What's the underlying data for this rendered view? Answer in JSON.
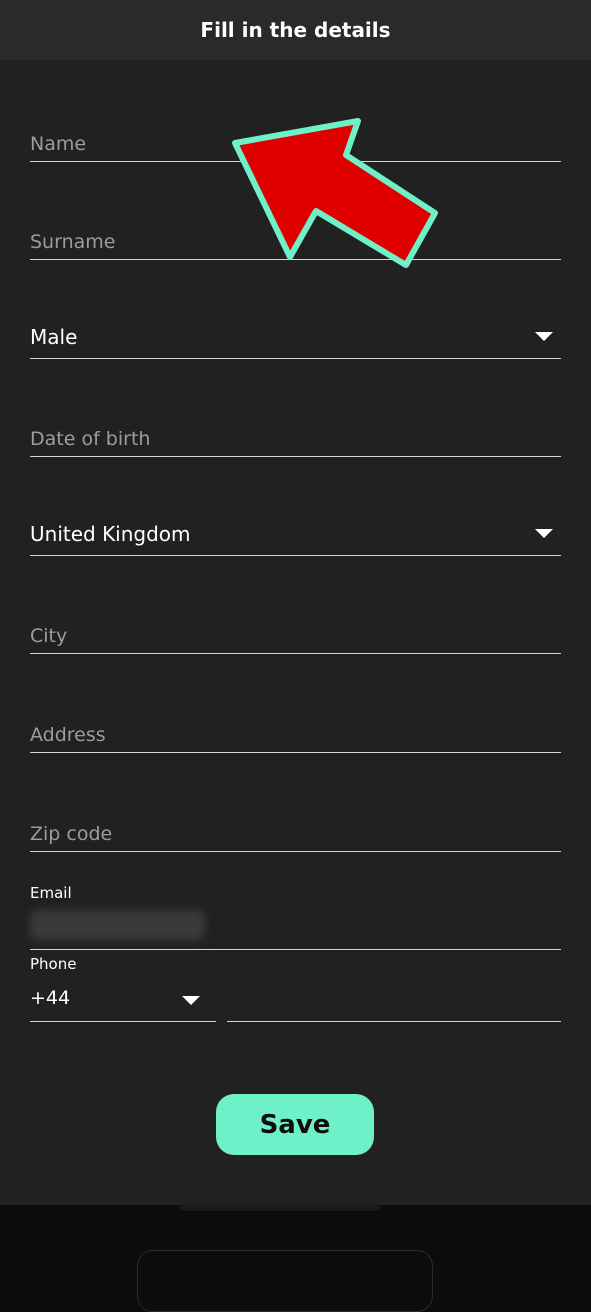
{
  "header": {
    "title": "Fill in the details"
  },
  "form": {
    "name": {
      "placeholder": "Name",
      "value": ""
    },
    "surname": {
      "placeholder": "Surname",
      "value": ""
    },
    "gender": {
      "selected": "Male"
    },
    "dob": {
      "placeholder": "Date of birth",
      "value": ""
    },
    "country": {
      "selected": "United Kingdom"
    },
    "city": {
      "placeholder": "City",
      "value": ""
    },
    "address": {
      "placeholder": "Address",
      "value": ""
    },
    "zip": {
      "placeholder": "Zip code",
      "value": ""
    },
    "email": {
      "label": "Email"
    },
    "phone": {
      "label": "Phone",
      "code": "+44",
      "value": ""
    }
  },
  "actions": {
    "save_label": "Save"
  },
  "colors": {
    "accent": "#6ef0c9",
    "arrow_fill": "#e00000",
    "arrow_outline": "#6ef0c9",
    "sheet_bg": "#212121",
    "header_bg": "#2a2a2a"
  },
  "icons": {
    "caret": "chevron-down-icon",
    "pointer": "arrow-icon"
  }
}
